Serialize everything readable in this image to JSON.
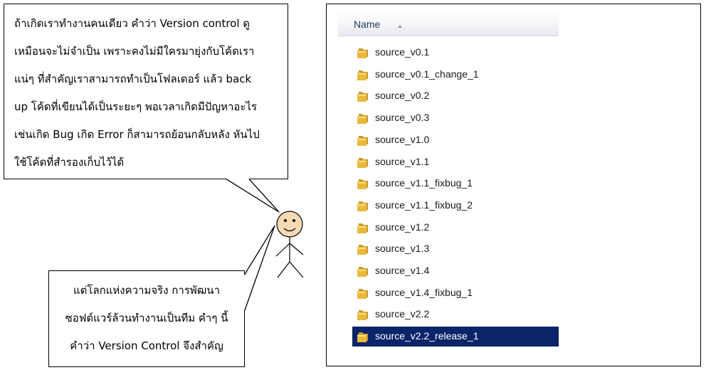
{
  "speech_top": {
    "lines": [
      "ถ้าเกิดเราทำงานคนเดียว คำว่า Version control ดู",
      "เหมือนจะไม่จำเป็น เพราะคงไม่มีใครมายุ่งกับโค้ดเรา",
      "แน่ๆ ที่สำคัญเราสามารถทำเป็นโฟลเดอร์ แล้ว back",
      "up โค้ดที่เขียนได้เป็นระยะๆ พอเวลาเกิดมีปัญหาอะไร",
      "เช่นเกิด Bug เกิด Error ก็สามารถย้อนกลับหลัง หันไป",
      "ใช้โค้ดที่สำรองเก็บไว้ได้"
    ]
  },
  "speech_bottom": {
    "lines": [
      "แต่โลกแห่งความจริง การพัฒนา",
      "ซอฟต์แวร์ล้วนทำงานเป็นทีม คำๆ นี้",
      "คำว่า Version Control จึงสำคัญ"
    ]
  },
  "explorer": {
    "column_header": "Name",
    "sort_icon": "sort-ascending-icon",
    "folder_icon": "folder-icon",
    "folder_color": "#e8b93c",
    "selection_color": "#0a246a",
    "items": [
      {
        "name": "source_v0.1",
        "selected": false
      },
      {
        "name": "source_v0.1_change_1",
        "selected": false
      },
      {
        "name": "source_v0.2",
        "selected": false
      },
      {
        "name": "source_v0.3",
        "selected": false
      },
      {
        "name": "source_v1.0",
        "selected": false
      },
      {
        "name": "source_v1.1",
        "selected": false
      },
      {
        "name": "source_v1.1_fixbug_1",
        "selected": false
      },
      {
        "name": "source_v1.1_fixbug_2",
        "selected": false
      },
      {
        "name": "source_v1.2",
        "selected": false
      },
      {
        "name": "source_v1.3",
        "selected": false
      },
      {
        "name": "source_v1.4",
        "selected": false
      },
      {
        "name": "source_v1.4_fixbug_1",
        "selected": false
      },
      {
        "name": "source_v2.2",
        "selected": false
      },
      {
        "name": "source_v2.2_release_1",
        "selected": true
      }
    ]
  },
  "character": {
    "icon": "stick-figure-icon",
    "face_color": "#f7d9b4"
  }
}
